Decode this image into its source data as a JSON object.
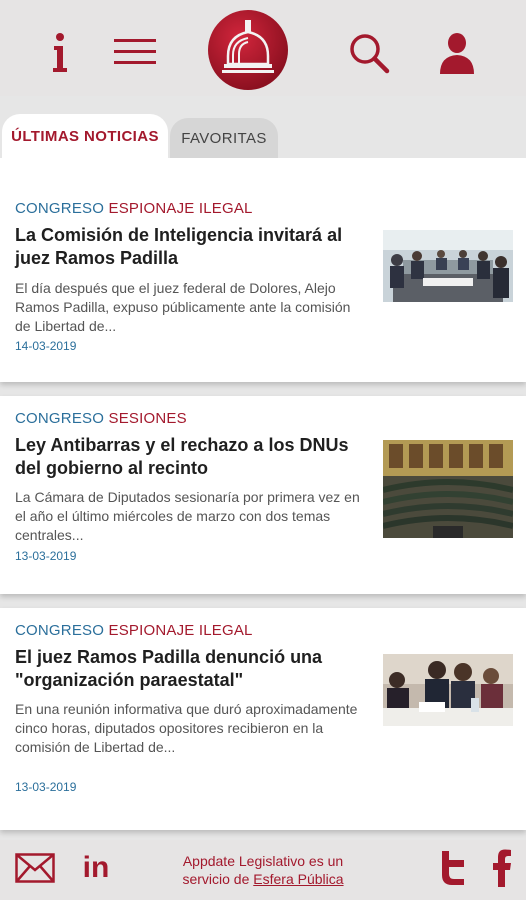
{
  "header": {
    "info_icon": "info-icon",
    "menu_icon": "hamburger-menu-icon",
    "logo_icon": "congress-dome-logo",
    "search_icon": "search-icon",
    "user_icon": "user-icon"
  },
  "tabs": [
    {
      "label": "ÚLTIMAS NOTICIAS",
      "active": true
    },
    {
      "label": "FAVORITAS",
      "active": false
    }
  ],
  "news": [
    {
      "category": "CONGRESO",
      "subcategory": "ESPIONAJE ILEGAL",
      "title": "La Comisión de Inteligencia invitará al juez Ramos Padilla",
      "summary": "El día después que el juez federal de Dolores, Alejo Ramos Padilla, expuso públicamente ante la comisión de Libertad de...",
      "date": "14-03-2019"
    },
    {
      "category": "CONGRESO",
      "subcategory": "SESIONES",
      "title": "Ley Antibarras y el rechazo a los DNUs del gobierno al recinto",
      "summary": "La Cámara de Diputados sesionaría por primera vez en el año el último miércoles de marzo con dos temas centrales...",
      "date": "13-03-2019"
    },
    {
      "category": "CONGRESO",
      "subcategory": "ESPIONAJE ILEGAL",
      "title": "El juez Ramos Padilla denunció una \"organización paraestatal\"",
      "summary": "En una reunión informativa que duró aproximadamente cinco horas, diputados opositores recibieron en la comisión de Libertad de...",
      "date": "13-03-2019"
    }
  ],
  "footer": {
    "credit_text": "Appdate Legislativo es un servicio de",
    "credit_link": "Esfera Pública",
    "linkedin_label": "in",
    "icons": [
      "mail-icon",
      "linkedin-icon",
      "twitter-icon",
      "facebook-icon"
    ]
  },
  "colors": {
    "accent": "#a3192d",
    "category_blue": "#2b6f9b",
    "header_bg": "#e6e4e4"
  }
}
